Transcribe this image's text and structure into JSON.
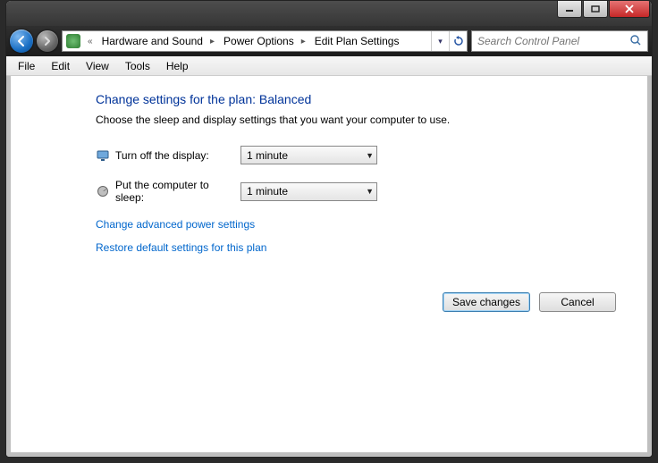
{
  "titlebar": {
    "min": "min",
    "max": "max",
    "close": "close"
  },
  "nav": {
    "back": "back",
    "forward": "forward",
    "crumb_leading": "«",
    "crumbs": [
      "Hardware and Sound",
      "Power Options",
      "Edit Plan Settings"
    ],
    "refresh": "↻"
  },
  "search": {
    "placeholder": "Search Control Panel"
  },
  "menu": {
    "items": [
      "File",
      "Edit",
      "View",
      "Tools",
      "Help"
    ]
  },
  "page": {
    "heading": "Change settings for the plan: Balanced",
    "description": "Choose the sleep and display settings that you want your computer to use.",
    "rows": [
      {
        "icon": "display-icon",
        "label": "Turn off the display:",
        "value": "1 minute"
      },
      {
        "icon": "sleep-icon",
        "label": "Put the computer to sleep:",
        "value": "1 minute"
      }
    ],
    "links": [
      "Change advanced power settings",
      "Restore default settings for this plan"
    ],
    "buttons": {
      "save": "Save changes",
      "cancel": "Cancel"
    }
  }
}
